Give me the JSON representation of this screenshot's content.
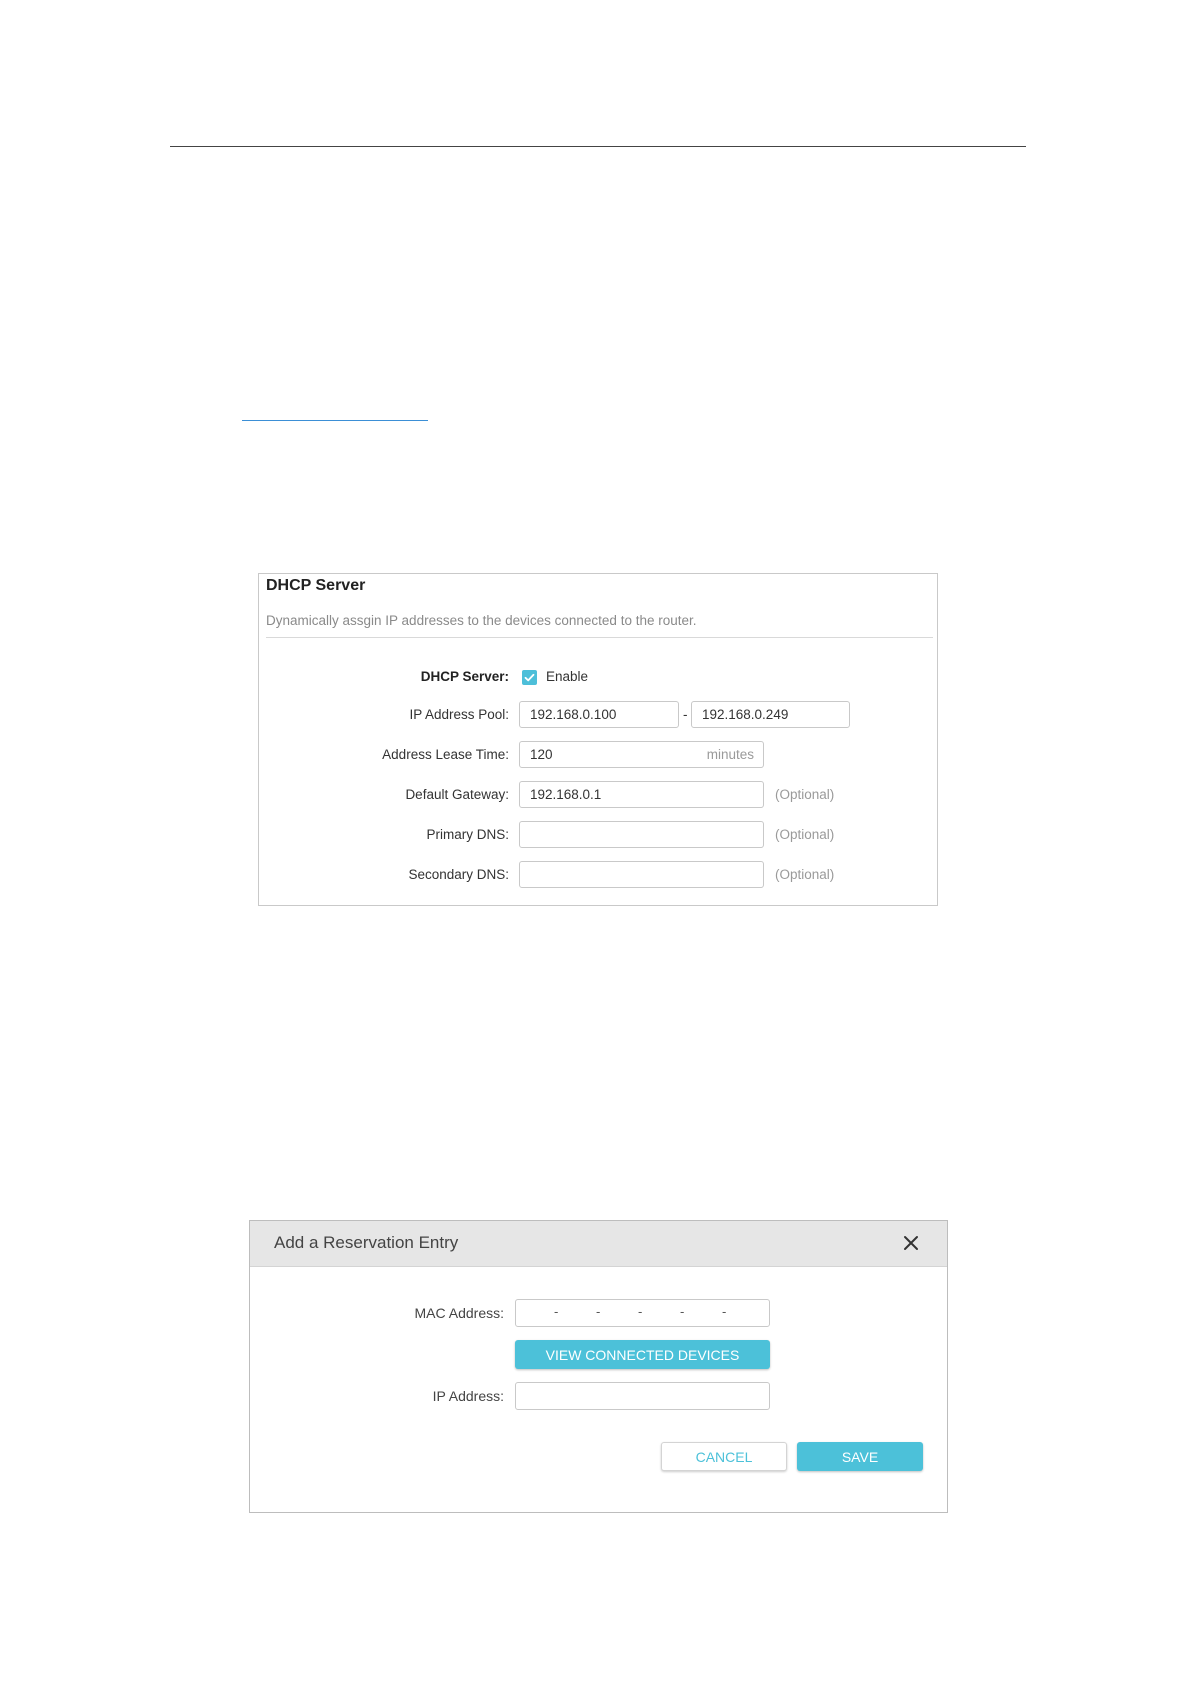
{
  "dhcp_panel": {
    "title": "DHCP Server",
    "description": "Dynamically assgin IP addresses to the devices connected to the router.",
    "server_label": "DHCP Server:",
    "enable_label": "Enable",
    "enable_checked": true,
    "pool_label": "IP Address Pool:",
    "pool_start": "192.168.0.100",
    "pool_separator": "-",
    "pool_end": "192.168.0.249",
    "lease_label": "Address Lease Time:",
    "lease_value": "120",
    "lease_unit": "minutes",
    "gateway_label": "Default Gateway:",
    "gateway_value": "192.168.0.1",
    "gateway_hint": "(Optional)",
    "primary_dns_label": "Primary DNS:",
    "primary_dns_value": "",
    "primary_dns_hint": "(Optional)",
    "secondary_dns_label": "Secondary DNS:",
    "secondary_dns_value": "",
    "secondary_dns_hint": "(Optional)",
    "accent_color": "#4dbfd9"
  },
  "reservation_dialog": {
    "title": "Add a Reservation Entry",
    "close_icon": "close-icon",
    "mac_label": "MAC Address:",
    "mac_separators": [
      "-",
      "-",
      "-",
      "-",
      "-"
    ],
    "view_devices_label": "VIEW CONNECTED DEVICES",
    "ip_label": "IP Address:",
    "ip_value": "",
    "cancel_label": "CANCEL",
    "save_label": "SAVE",
    "accent_color": "#4cc1d9"
  }
}
